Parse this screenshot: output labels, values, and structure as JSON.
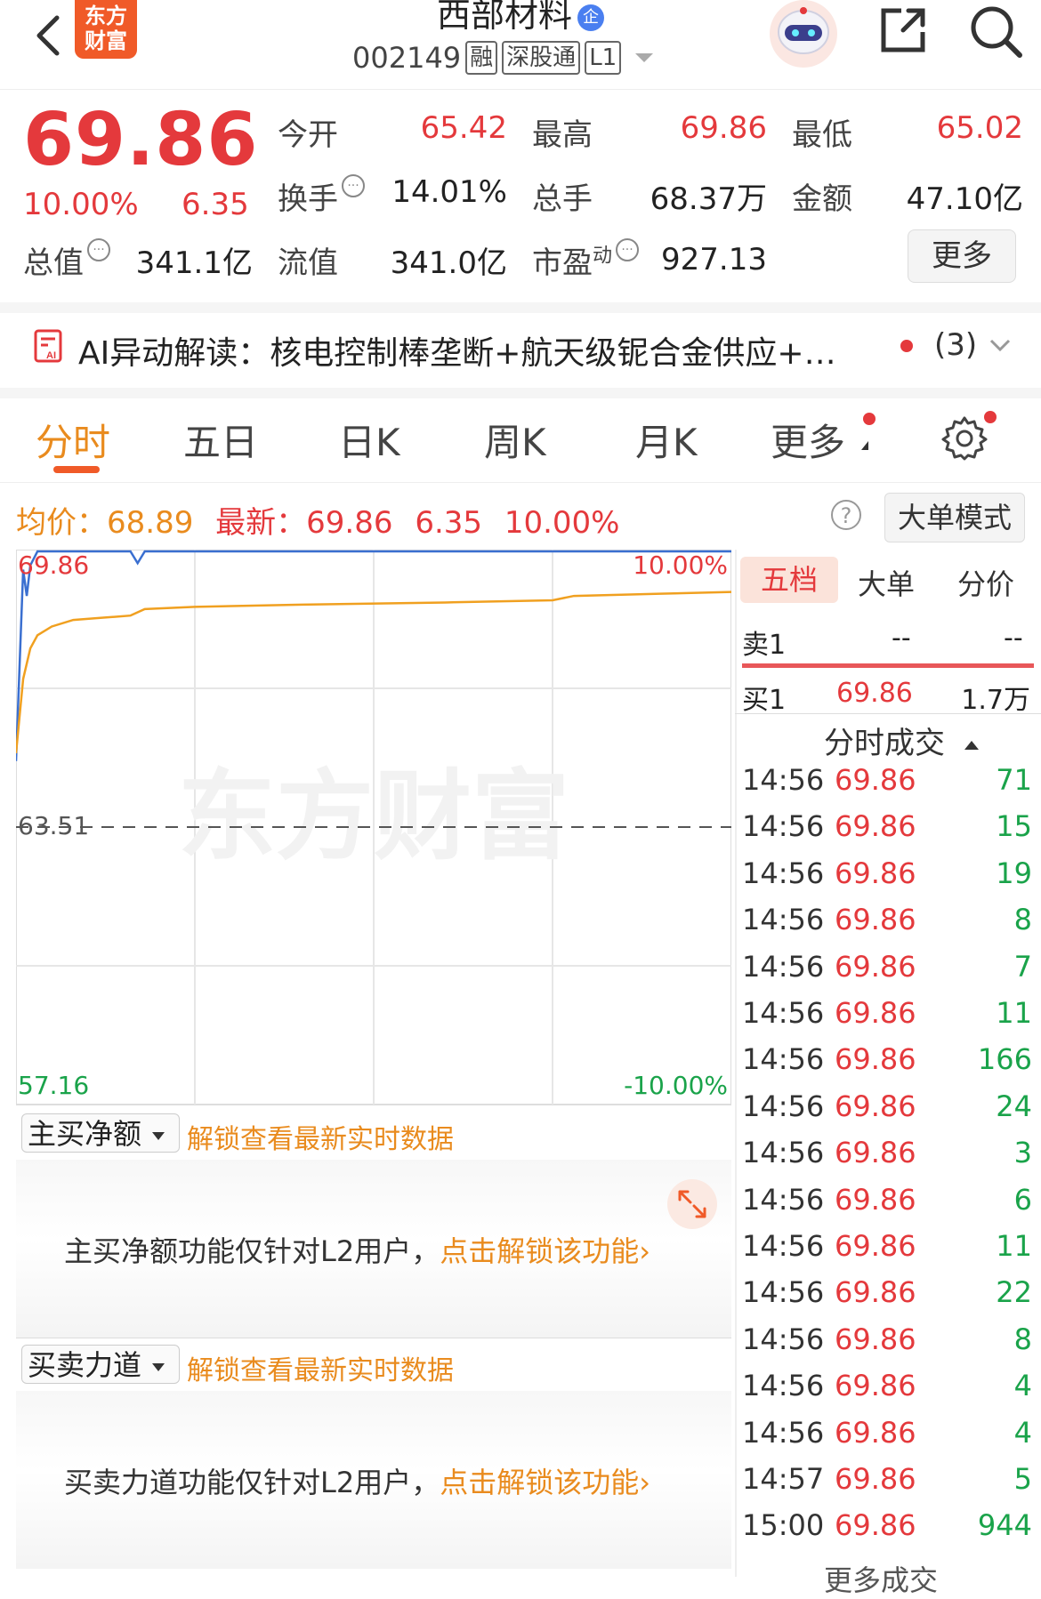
{
  "header": {
    "logo_text": "东方\n财富",
    "stock_name": "西部材料",
    "badge_qi": "企",
    "stock_code": "002149",
    "tags": [
      "融",
      "深股通",
      "L1"
    ]
  },
  "quote": {
    "price": "69.86",
    "change_pct": "10.00%",
    "change_amt": "6.35",
    "fields": [
      {
        "label": "今开",
        "value": "65.42",
        "color": "red"
      },
      {
        "label": "最高",
        "value": "69.86",
        "color": "red"
      },
      {
        "label": "最低",
        "value": "65.02",
        "color": "red"
      },
      {
        "label": "换手",
        "value": "14.01%",
        "color": "black"
      },
      {
        "label": "总手",
        "value": "68.37万",
        "color": "black"
      },
      {
        "label": "金额",
        "value": "47.10亿",
        "color": "black"
      },
      {
        "label": "总值",
        "value": "341.1亿",
        "color": "black"
      },
      {
        "label": "流值",
        "value": "341.0亿",
        "color": "black"
      },
      {
        "label": "市盈",
        "label_sup": "动",
        "value": "927.13",
        "color": "black"
      }
    ],
    "more_label": "更多"
  },
  "ai_bar": {
    "text": "AI异动解读：核电控制棒垄断+航天级铌合金供应+…",
    "count": "(3)"
  },
  "tabs": [
    "分时",
    "五日",
    "日K",
    "周K",
    "月K",
    "更多"
  ],
  "info": {
    "avg_label": "均价：",
    "avg_value": "68.89",
    "latest_label": "最新：",
    "latest_value": "69.86",
    "latest_change": "6.35",
    "latest_pct": "10.00%",
    "help": "?",
    "mode_button": "大单模式"
  },
  "chart_data": {
    "type": "line",
    "y_left_top": "69.86",
    "y_left_mid": "63.51",
    "y_left_bottom": "57.16",
    "y_right_top": "10.00%",
    "y_right_bottom": "-10.00%",
    "ylim": [
      57.16,
      69.86
    ],
    "prev_close": 63.51,
    "watermark": "东方财富",
    "series": [
      {
        "color": "#3a6fd0",
        "x": [
          0,
          0.01,
          0.015,
          0.02,
          0.03,
          0.04,
          0.05,
          0.16,
          0.17,
          0.18,
          1.0
        ],
        "y": [
          65.02,
          69.4,
          68.8,
          69.5,
          69.86,
          69.86,
          69.86,
          69.86,
          69.55,
          69.86,
          69.86
        ]
      },
      {
        "color": "#f0a020",
        "x": [
          0,
          0.01,
          0.02,
          0.03,
          0.05,
          0.08,
          0.12,
          0.16,
          0.18,
          0.25,
          0.4,
          0.6,
          0.75,
          0.78,
          0.9,
          1.0
        ],
        "y": [
          65.2,
          66.9,
          67.6,
          67.9,
          68.1,
          68.25,
          68.3,
          68.35,
          68.5,
          68.55,
          68.6,
          68.65,
          68.7,
          68.8,
          68.85,
          68.89
        ]
      }
    ]
  },
  "panels": [
    {
      "dropdown": "主买净额",
      "unlock_link": "解锁查看最新实时数据",
      "message": "主买净额功能仅针对L2用户，",
      "message_link": "点击解锁该功能",
      "chevron": "›"
    },
    {
      "dropdown": "买卖力道",
      "unlock_link": "解锁查看最新实时数据",
      "message": "买卖力道功能仅针对L2用户，",
      "message_link": "点击解锁该功能",
      "chevron": "›"
    }
  ],
  "right_panel": {
    "tabs": [
      "五档",
      "大单",
      "分价"
    ],
    "sell1": {
      "label": "卖1",
      "price": "--",
      "vol": "--"
    },
    "buy1": {
      "label": "买1",
      "price": "69.86",
      "vol": "1.7万"
    },
    "trades_header": "分时成交",
    "trades": [
      {
        "time": "14:56",
        "price": "69.86",
        "vol": "71"
      },
      {
        "time": "14:56",
        "price": "69.86",
        "vol": "15"
      },
      {
        "time": "14:56",
        "price": "69.86",
        "vol": "19"
      },
      {
        "time": "14:56",
        "price": "69.86",
        "vol": "8"
      },
      {
        "time": "14:56",
        "price": "69.86",
        "vol": "7"
      },
      {
        "time": "14:56",
        "price": "69.86",
        "vol": "11"
      },
      {
        "time": "14:56",
        "price": "69.86",
        "vol": "166"
      },
      {
        "time": "14:56",
        "price": "69.86",
        "vol": "24"
      },
      {
        "time": "14:56",
        "price": "69.86",
        "vol": "3"
      },
      {
        "time": "14:56",
        "price": "69.86",
        "vol": "6"
      },
      {
        "time": "14:56",
        "price": "69.86",
        "vol": "11"
      },
      {
        "time": "14:56",
        "price": "69.86",
        "vol": "22"
      },
      {
        "time": "14:56",
        "price": "69.86",
        "vol": "8"
      },
      {
        "time": "14:56",
        "price": "69.86",
        "vol": "4"
      },
      {
        "time": "14:56",
        "price": "69.86",
        "vol": "4"
      },
      {
        "time": "14:57",
        "price": "69.86",
        "vol": "5"
      },
      {
        "time": "15:00",
        "price": "69.86",
        "vol": "944"
      }
    ],
    "more_trades": "更多成交"
  },
  "colors": {
    "up": "#e4393c",
    "down": "#1aa34a",
    "accent": "#e98b1e",
    "brand": "#f05a28"
  }
}
